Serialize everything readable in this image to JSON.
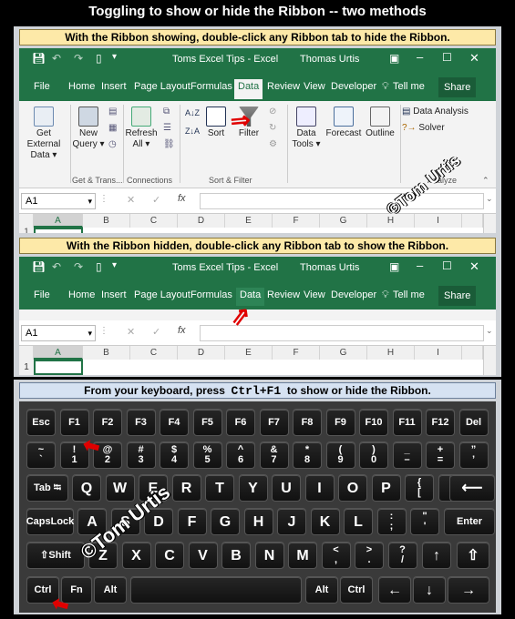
{
  "title": "Toggling to show or hide the Ribbon -- two methods",
  "section1": {
    "instruction": "With the Ribbon showing, double-click any Ribbon tab to hide the Ribbon."
  },
  "section2": {
    "instruction": "With the Ribbon hidden, double-click any Ribbon tab to show the Ribbon."
  },
  "section3": {
    "instruction_pre": "From your keyboard, press",
    "shortcut": "Ctrl+F1",
    "instruction_post": "to show or hide the Ribbon."
  },
  "window": {
    "doc_title": "Toms Excel Tips  -  Excel",
    "user": "Thomas Urtis",
    "tell_me": "Tell me",
    "share": "Share"
  },
  "tabs": [
    "File",
    "Home",
    "Insert",
    "Page Layout",
    "Formulas",
    "Data",
    "Review",
    "View",
    "Developer"
  ],
  "ribbon": {
    "get_external": "Get External Data ▾",
    "new_query": "New Query ▾",
    "refresh_all": "Refresh All ▾",
    "sort": "Sort",
    "filter": "Filter",
    "data_tools": "Data Tools ▾",
    "forecast": "Forecast",
    "outline": "Outline",
    "data_analysis": "Data Analysis",
    "solver": "Solver",
    "groups": {
      "get_trans": "Get & Trans...",
      "connections": "Connections",
      "sort_filter": "Sort & Filter",
      "analyze": "Analyze"
    }
  },
  "formula_bar": {
    "name_box": "A1",
    "fx": "fx",
    "cancel": "✕",
    "enter": "✓"
  },
  "columns": [
    "A",
    "B",
    "C",
    "D",
    "E",
    "F",
    "G",
    "H",
    "I"
  ],
  "row_label": "1",
  "watermark": "©Tom Urtis",
  "keyboard": {
    "row1": [
      "Esc",
      "F1",
      "F2",
      "F3",
      "F4",
      "F5",
      "F6",
      "F7",
      "F8",
      "F9",
      "F10",
      "F11",
      "F12",
      "Del"
    ],
    "row2": [
      [
        "~",
        "`"
      ],
      [
        "!",
        "1"
      ],
      [
        "@",
        "2"
      ],
      [
        "#",
        "3"
      ],
      [
        "$",
        "4"
      ],
      [
        "%",
        "5"
      ],
      [
        "^",
        "6"
      ],
      [
        "&",
        "7"
      ],
      [
        "*",
        "8"
      ],
      [
        "(",
        "9"
      ],
      [
        ")",
        "0"
      ],
      [
        "_",
        "–"
      ],
      [
        "+",
        "="
      ],
      [
        "”",
        "’"
      ]
    ],
    "row3": [
      "Tab ⭾",
      "Q",
      "W",
      "E",
      "R",
      "T",
      "Y",
      "U",
      "I",
      "O",
      "P",
      [
        "{",
        "["
      ],
      [
        "}",
        "]"
      ],
      "⟵"
    ],
    "row4": [
      "CapsLock",
      "A",
      "S",
      "D",
      "F",
      "G",
      "H",
      "J",
      "K",
      "L",
      [
        ":",
        ";"
      ],
      [
        "\"",
        "'"
      ],
      "Enter"
    ],
    "row5": [
      "⇧Shift",
      "Z",
      "X",
      "C",
      "V",
      "B",
      "N",
      "M",
      [
        "<",
        ","
      ],
      [
        ">",
        "."
      ],
      [
        "?",
        "/"
      ],
      "↑",
      "⇧"
    ],
    "row6": [
      "Ctrl",
      "Fn",
      "Alt",
      "",
      "Alt",
      "Ctrl",
      "←",
      "↓",
      "→"
    ]
  }
}
